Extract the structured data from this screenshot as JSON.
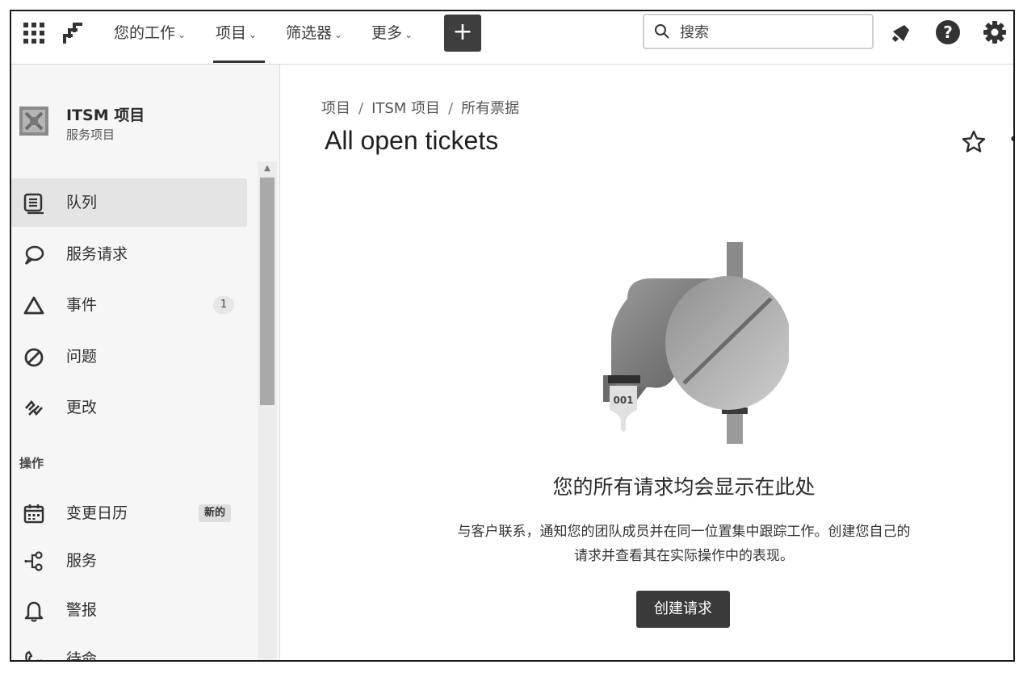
{
  "topnav": {
    "items": [
      {
        "label": "您的工作"
      },
      {
        "label": "项目"
      },
      {
        "label": "筛选器"
      },
      {
        "label": "更多"
      }
    ],
    "create_label": "+",
    "search": {
      "placeholder": "搜索"
    }
  },
  "sidebar": {
    "project": {
      "name": "ITSM 项目",
      "type": "服务项目"
    },
    "items": [
      {
        "label": "队列",
        "icon": "queue-icon",
        "active": true
      },
      {
        "label": "服务请求",
        "icon": "speech-bubble-icon"
      },
      {
        "label": "事件",
        "icon": "warning-triangle-icon",
        "count": "1"
      },
      {
        "label": "问题",
        "icon": "prohibited-icon"
      },
      {
        "label": "更改",
        "icon": "change-arrows-icon"
      }
    ],
    "section_ops": "操作",
    "ops_items": [
      {
        "label": "变更日历",
        "icon": "calendar-icon",
        "badge": "新的"
      },
      {
        "label": "服务",
        "icon": "services-icon"
      },
      {
        "label": "警报",
        "icon": "bell-icon"
      },
      {
        "label": "待命",
        "icon": "on-call-phone-icon"
      }
    ]
  },
  "main": {
    "breadcrumb": [
      "项目",
      "ITSM 项目",
      "所有票据"
    ],
    "title": "All open tickets",
    "illustration": {
      "ticket_number": "001"
    },
    "empty_state": {
      "title": "您的所有请求均会显示在此处",
      "description_line1": "与客户联系，通知您的团队成员并在同一位置集中跟踪工作。创建您自己的",
      "description_line2": "请求并查看其在实际操作中的表现。",
      "button_label": "创建请求"
    }
  }
}
